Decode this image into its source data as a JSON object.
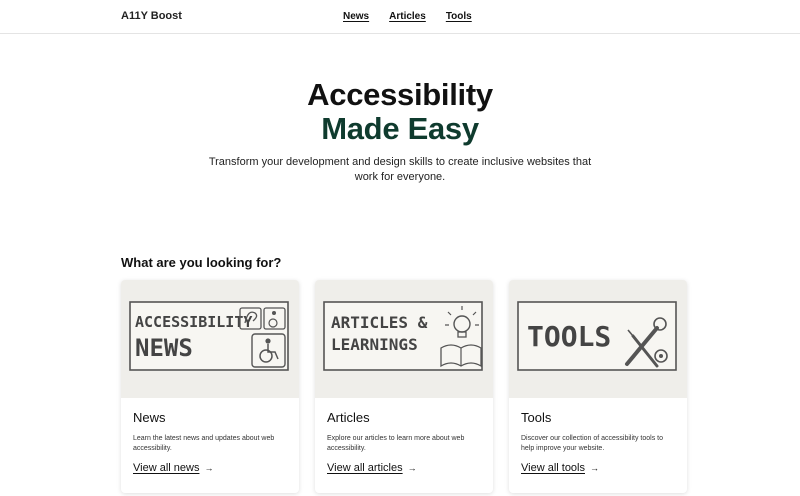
{
  "header": {
    "logo": "A11Y Boost",
    "nav": [
      "News",
      "Articles",
      "Tools"
    ]
  },
  "hero": {
    "title_line1": "Accessibility",
    "title_line2": "Made Easy",
    "subtitle": "Transform your development and design skills to create inclusive websites that work for everyone."
  },
  "section": {
    "heading": "What are you looking for?"
  },
  "cards": [
    {
      "image_text": [
        "ACCESSIBILITY",
        "NEWS"
      ],
      "title": "News",
      "description": "Learn the latest news and updates about web accessibility.",
      "link": "View all news"
    },
    {
      "image_text": [
        "ARTICLES &",
        "LEARNINGS"
      ],
      "title": "Articles",
      "description": "Explore our articles to learn more about web accessibility.",
      "link": "View all articles"
    },
    {
      "image_text": [
        "TOOLS"
      ],
      "title": "Tools",
      "description": "Discover our collection of accessibility tools to help improve your website.",
      "link": "View all tools"
    }
  ],
  "icons": {
    "arrow": "→"
  },
  "colors": {
    "accent_green": "#0f3b2e",
    "image_bg": "#efeeea"
  }
}
